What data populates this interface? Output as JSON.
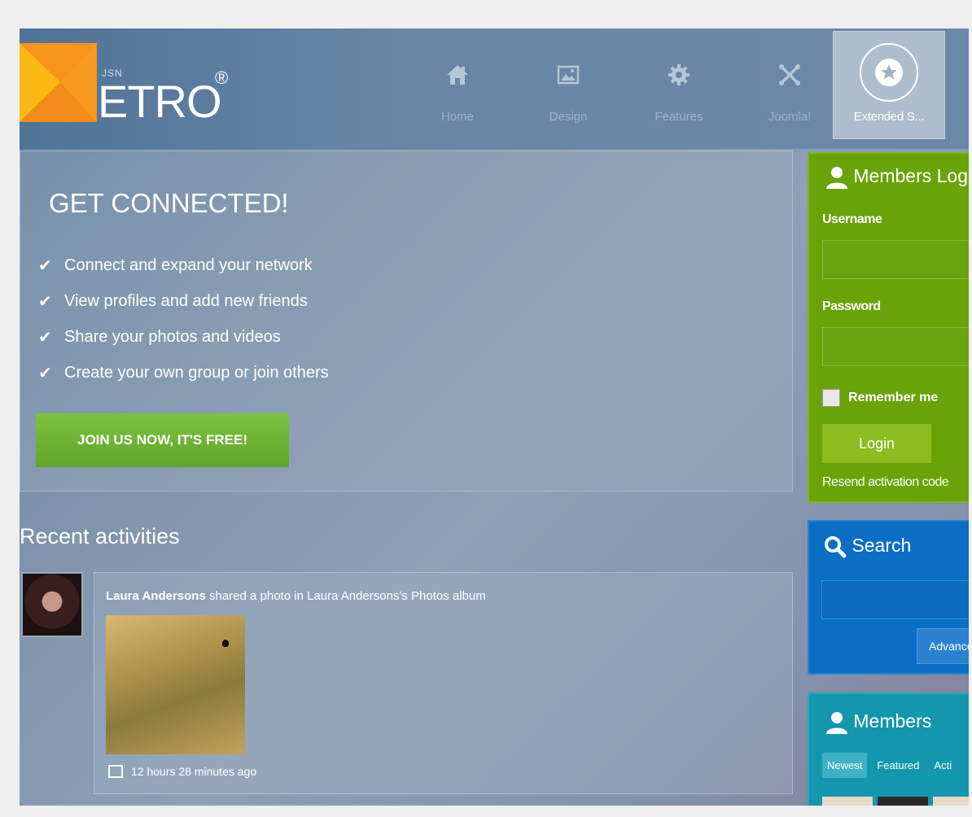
{
  "header": {
    "logo_small": "JSN",
    "logo_text": "ETRO",
    "logo_reg": "®",
    "nav": [
      {
        "label": "Home",
        "icon": "home-icon"
      },
      {
        "label": "Design",
        "icon": "image-icon"
      },
      {
        "label": "Features",
        "icon": "gear-icon"
      },
      {
        "label": "Joomla!",
        "icon": "joomla-icon"
      }
    ],
    "active_nav": {
      "label": "Extended S...",
      "icon": "star-icon"
    }
  },
  "connect": {
    "title": "GET CONNECTED!",
    "features": [
      "Connect and expand your network",
      "View profiles and add new friends",
      "Share your photos and videos",
      "Create your own group or join others"
    ],
    "join_label": "JOIN US NOW, IT'S FREE!"
  },
  "activities": {
    "title": "Recent activities",
    "item": {
      "user": "Laura Andersons",
      "text": "shared a photo in Laura Andersons's Photos album",
      "time": "12 hours 28 minutes ago"
    }
  },
  "login": {
    "title": "Members Log",
    "username_label": "Username",
    "username_value": "",
    "password_label": "Password",
    "password_value": "",
    "remember_label": "Remember me",
    "login_label": "Login",
    "resend_label": "Resend activation code"
  },
  "search": {
    "title": "Search",
    "input_value": "",
    "advanced_label": "Advance"
  },
  "members": {
    "title": "Members",
    "tabs": [
      "Newest",
      "Featured",
      "Acti"
    ]
  },
  "colors": {
    "login_bg": "#69a308",
    "search_bg": "#0a6ec4",
    "members_bg": "#1397ad",
    "join_button": "#6fb533",
    "logo_orange": "#f7941d",
    "logo_yellow": "#fbb814"
  }
}
